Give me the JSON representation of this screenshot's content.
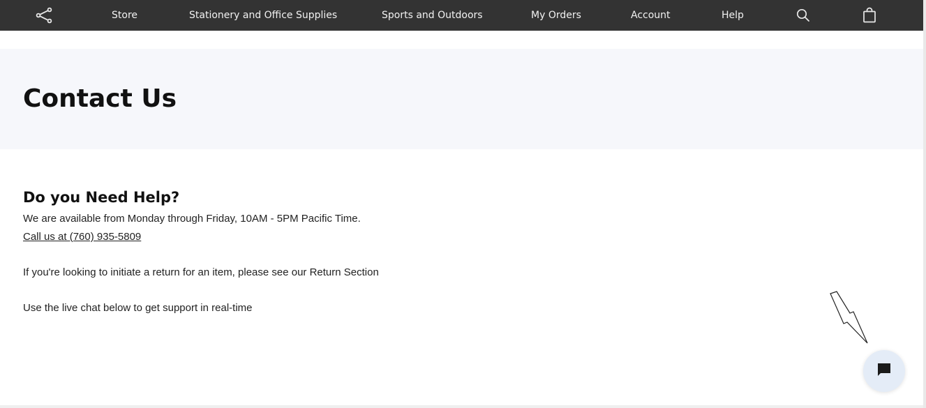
{
  "nav": {
    "items": [
      {
        "label": "Store"
      },
      {
        "label": "Stationery and Office Supplies"
      },
      {
        "label": "Sports and Outdoors"
      },
      {
        "label": "My Orders"
      },
      {
        "label": "Account"
      },
      {
        "label": "Help"
      }
    ],
    "icons": {
      "share": "share-icon",
      "search": "search-icon",
      "cart": "shopping-bag-icon"
    },
    "background": "#333333",
    "text_color": "#f2f2f2"
  },
  "hero": {
    "title": "Contact Us",
    "background": "#f6f7fb"
  },
  "help": {
    "heading": "Do you Need Help?",
    "availability": "We are available from Monday through Friday, 10AM - 5PM Pacific Time.",
    "phone_link": "Call us at (760) 935-5809",
    "returns_text": "If you're looking to initiate a return for an item, please see our Return Section",
    "chat_text": "Use the live chat below to get support in real-time"
  },
  "chat_widget": {
    "icon": "chat-bubble-icon",
    "background": "#e4ecf7"
  }
}
